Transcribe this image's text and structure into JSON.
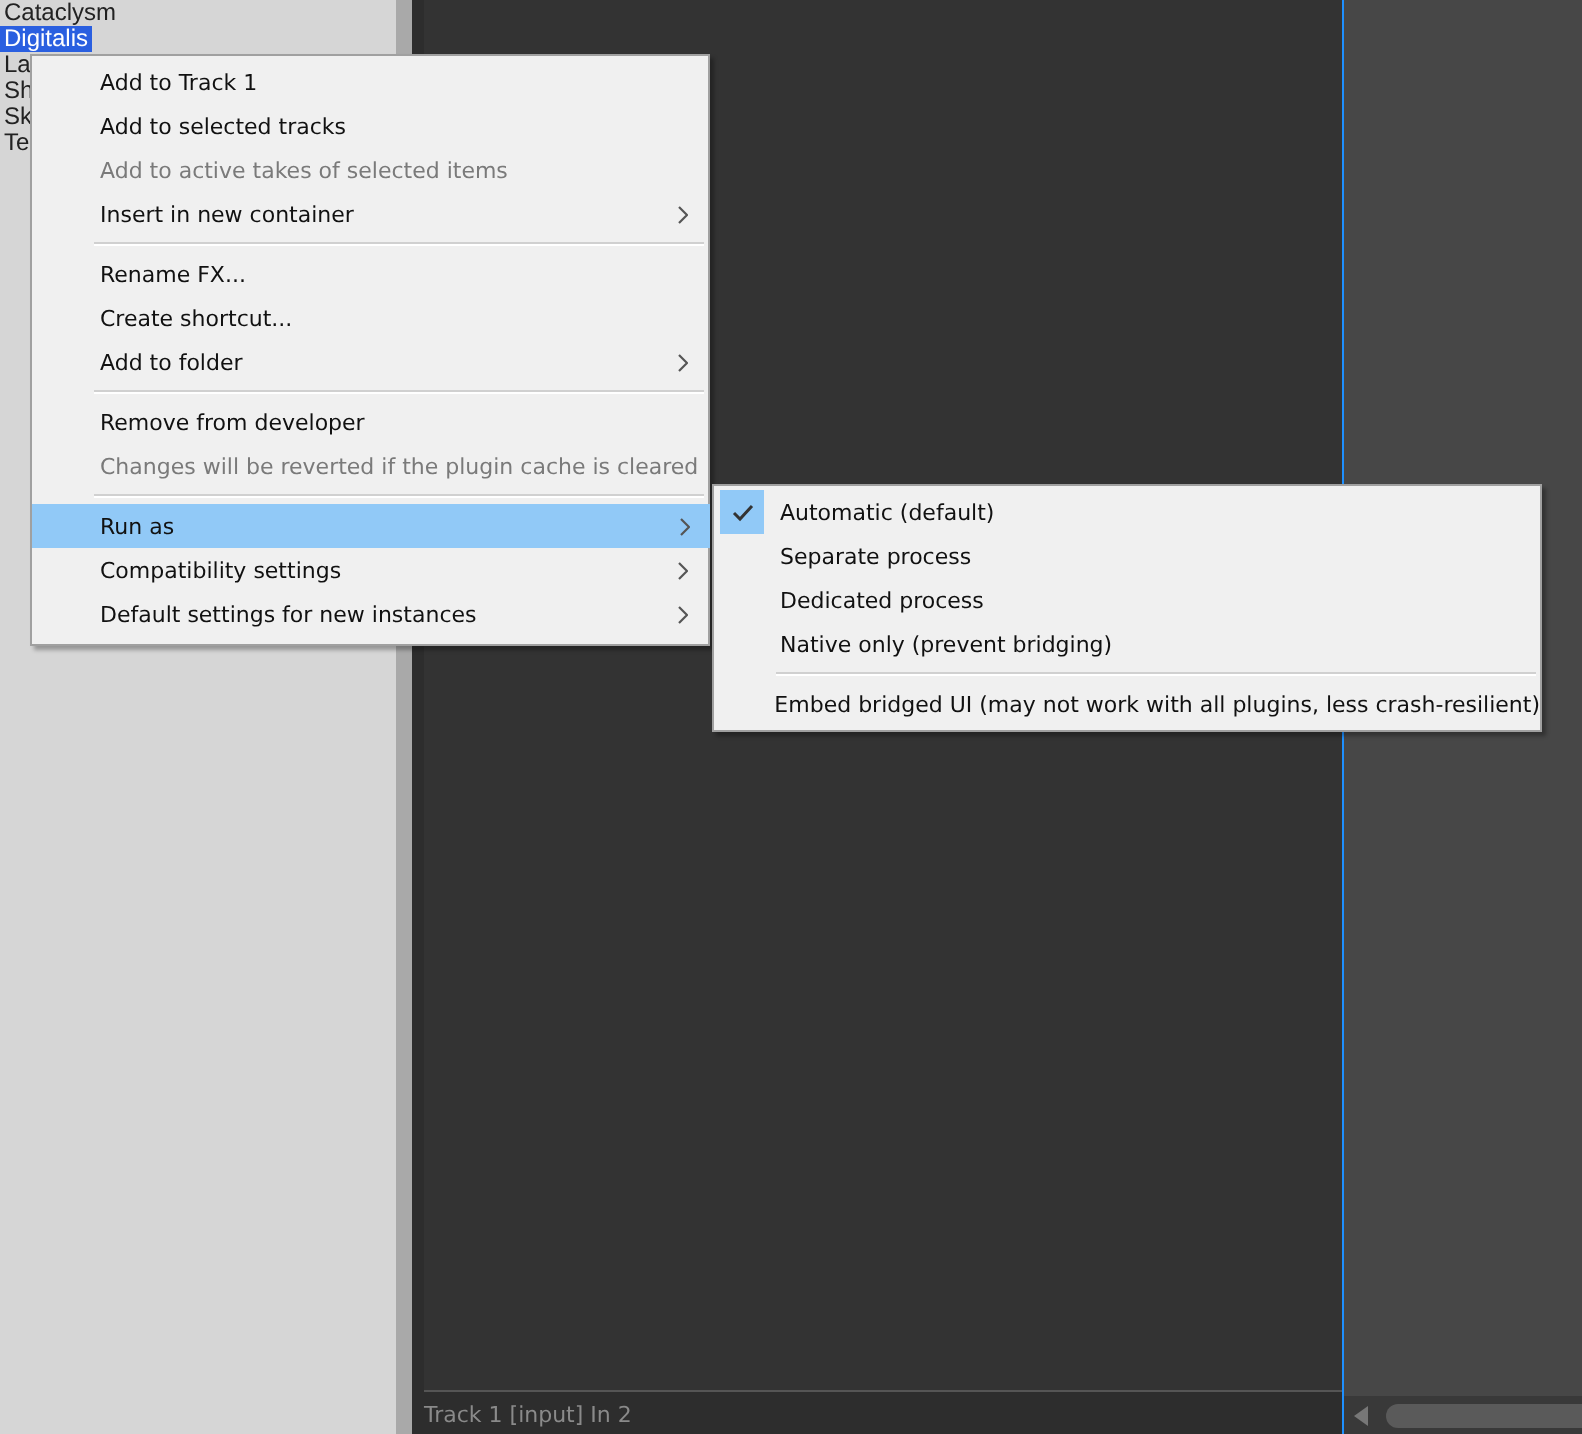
{
  "fx_list": {
    "items": [
      {
        "label": "Cataclysm",
        "selected": false
      },
      {
        "label": "Digitalis",
        "selected": true
      },
      {
        "label": "La",
        "selected": false
      },
      {
        "label": "Sh",
        "selected": false
      },
      {
        "label": "Sk",
        "selected": false
      },
      {
        "label": "Te",
        "selected": false
      }
    ]
  },
  "context_menu": {
    "items": [
      {
        "kind": "item",
        "label": "Add to Track 1",
        "disabled": false,
        "submenu": false,
        "selected": false
      },
      {
        "kind": "item",
        "label": "Add to selected tracks",
        "disabled": false,
        "submenu": false,
        "selected": false
      },
      {
        "kind": "item",
        "label": "Add to active takes of selected items",
        "disabled": true,
        "submenu": false,
        "selected": false
      },
      {
        "kind": "item",
        "label": "Insert in new container",
        "disabled": false,
        "submenu": true,
        "selected": false
      },
      {
        "kind": "separator"
      },
      {
        "kind": "item",
        "label": "Rename FX...",
        "disabled": false,
        "submenu": false,
        "selected": false
      },
      {
        "kind": "item",
        "label": "Create shortcut...",
        "disabled": false,
        "submenu": false,
        "selected": false
      },
      {
        "kind": "item",
        "label": "Add to folder",
        "disabled": false,
        "submenu": true,
        "selected": false
      },
      {
        "kind": "separator"
      },
      {
        "kind": "item",
        "label": "Remove from developer",
        "disabled": false,
        "submenu": false,
        "selected": false
      },
      {
        "kind": "item",
        "label": "Changes will be reverted if the plugin cache is cleared",
        "disabled": true,
        "submenu": false,
        "selected": false
      },
      {
        "kind": "separator"
      },
      {
        "kind": "item",
        "label": "Run as",
        "disabled": false,
        "submenu": true,
        "selected": true
      },
      {
        "kind": "item",
        "label": "Compatibility settings",
        "disabled": false,
        "submenu": true,
        "selected": false
      },
      {
        "kind": "item",
        "label": "Default settings for new instances",
        "disabled": false,
        "submenu": true,
        "selected": false
      }
    ]
  },
  "submenu": {
    "items": [
      {
        "kind": "item",
        "label": "Automatic (default)",
        "checked": true
      },
      {
        "kind": "item",
        "label": "Separate process",
        "checked": false
      },
      {
        "kind": "item",
        "label": "Dedicated process",
        "checked": false
      },
      {
        "kind": "item",
        "label": "Native only (prevent bridging)",
        "checked": false
      },
      {
        "kind": "separator"
      },
      {
        "kind": "item",
        "label": "Embed bridged UI (may not work with all plugins, less crash-resilient)",
        "checked": false
      }
    ]
  },
  "status_bar": {
    "text": "Track 1 [input] In 2"
  }
}
